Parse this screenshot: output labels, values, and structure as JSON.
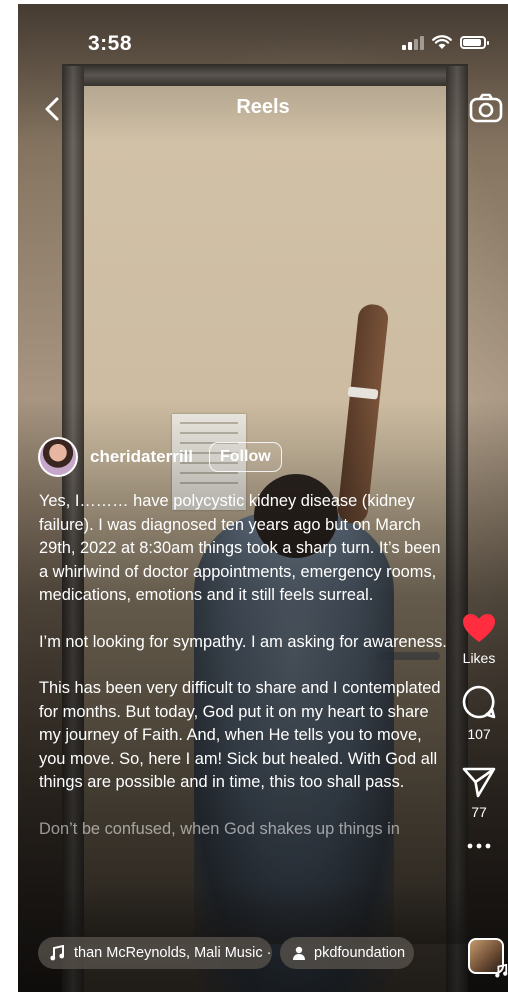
{
  "status_bar": {
    "time": "3:58"
  },
  "header": {
    "title": "Reels"
  },
  "post": {
    "username": "cheridaterrill",
    "follow_label": "Follow",
    "caption": [
      "Yes, I……… have polycystic kidney disease (kidney failure). I was diagnosed ten years ago but on March 29th, 2022 at 8:30am things took a sharp turn. It’s been a whirlwind of doctor appointments, emergency rooms, medications, emotions and it still feels surreal.",
      "I’m not looking for sympathy. I am asking for awareness.",
      "This has been very difficult to share and I contemplated for months. But today, God put it on my heart to share my journey of Faith. And, when He tells you to move, you move. So, here I am! Sick but healed. With God all things are possible and in time, this too shall pass.",
      "Don’t be confused, when God shakes up things in"
    ],
    "audio_label": "than McReynolds, Mali Music · ",
    "tagged_user": "pkdfoundation"
  },
  "actions": {
    "likes_label": "Likes",
    "comments_count": "107",
    "shares_count": "77"
  },
  "colors": {
    "like": "#ff2d3f",
    "text": "#ffffff"
  },
  "icons": [
    "back-icon",
    "camera-icon",
    "heart-icon",
    "comment-icon",
    "send-icon",
    "more-icon",
    "music-note-icon",
    "person-icon"
  ]
}
